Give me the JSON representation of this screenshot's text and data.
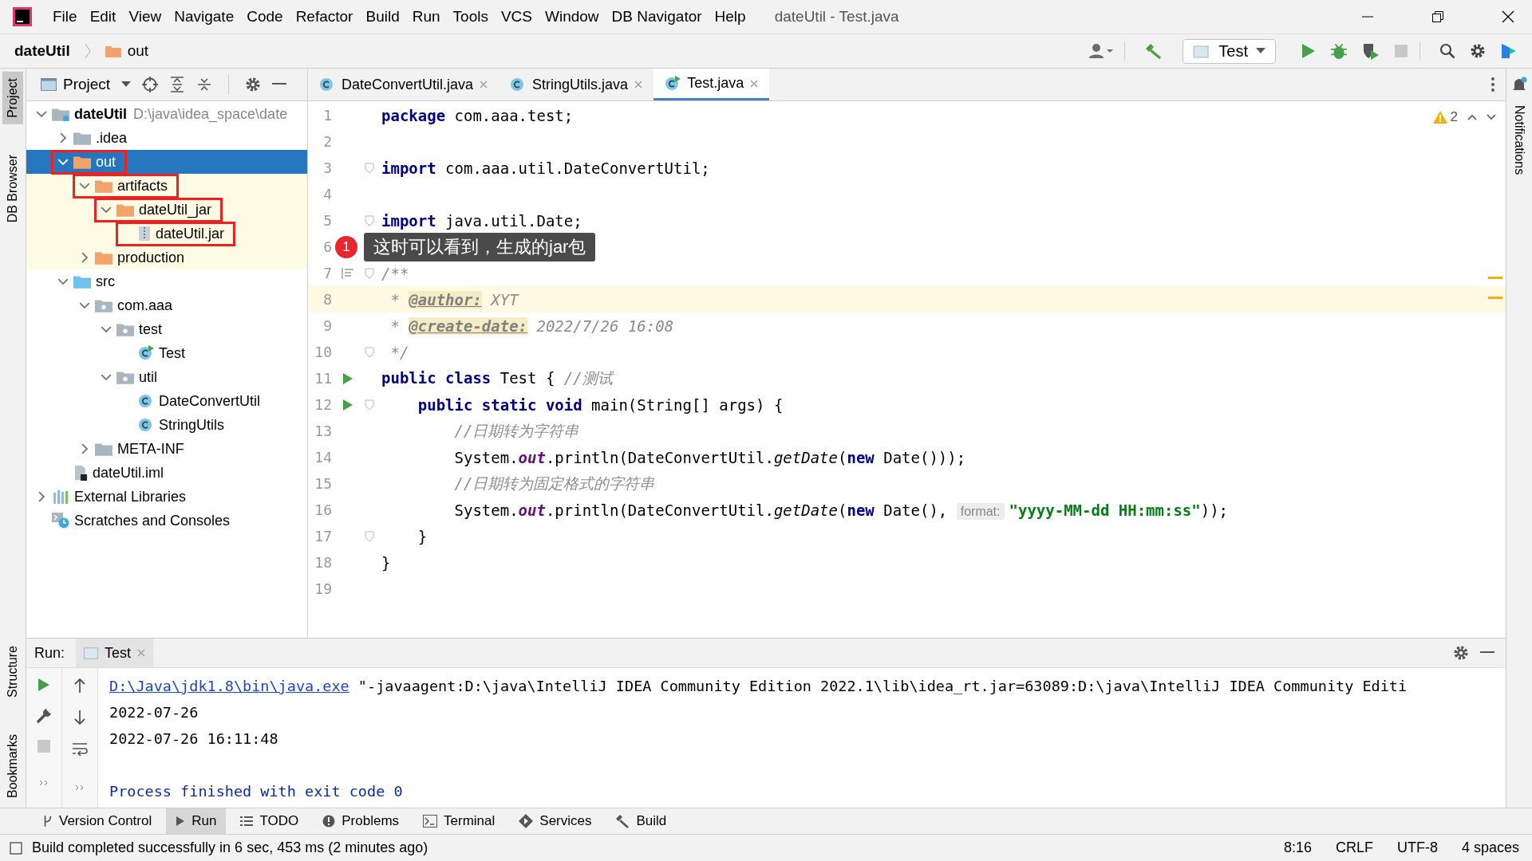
{
  "window": {
    "title": "dateUtil - Test.java"
  },
  "menu": [
    "File",
    "Edit",
    "View",
    "Navigate",
    "Code",
    "Refactor",
    "Build",
    "Run",
    "Tools",
    "VCS",
    "Window",
    "DB Navigator",
    "Help"
  ],
  "breadcrumb": [
    {
      "label": "dateUtil",
      "kind": "project"
    },
    {
      "label": "out",
      "kind": "folder"
    }
  ],
  "run_config": {
    "label": "Test"
  },
  "left_stripe_top": [
    {
      "label": "Project",
      "selected": true
    },
    {
      "label": "DB Browser",
      "selected": false
    }
  ],
  "left_stripe_bottom": [
    {
      "label": "Structure",
      "selected": false
    },
    {
      "label": "Bookmarks",
      "selected": false
    }
  ],
  "right_stripe": [
    {
      "label": "Notifications",
      "selected": false
    }
  ],
  "project_panel": {
    "title": "Project",
    "tree": [
      {
        "label": "dateUtil",
        "location": "D:\\java\\idea_space\\date",
        "kind": "module",
        "expanded": true,
        "selected": false,
        "excluded": false,
        "highlighted": false,
        "children": [
          {
            "label": ".idea",
            "kind": "folder",
            "expanded": false,
            "selected": false,
            "excluded": false,
            "highlighted": false
          },
          {
            "label": "out",
            "kind": "folder",
            "expanded": true,
            "selected": true,
            "excluded": true,
            "highlighted": true,
            "children": [
              {
                "label": "artifacts",
                "kind": "folder",
                "expanded": true,
                "selected": false,
                "excluded": true,
                "highlighted": true,
                "children": [
                  {
                    "label": "dateUtil_jar",
                    "kind": "folder",
                    "expanded": true,
                    "selected": false,
                    "excluded": true,
                    "highlighted": true,
                    "children": [
                      {
                        "label": "dateUtil.jar",
                        "kind": "jar",
                        "selected": false,
                        "excluded": true,
                        "highlighted": true
                      }
                    ]
                  }
                ]
              },
              {
                "label": "production",
                "kind": "folder",
                "expanded": false,
                "selected": false,
                "excluded": true,
                "highlighted": false
              }
            ]
          },
          {
            "label": "src",
            "kind": "source",
            "expanded": true,
            "selected": false,
            "excluded": false,
            "highlighted": false,
            "children": [
              {
                "label": "com.aaa",
                "kind": "package",
                "expanded": true,
                "selected": false,
                "excluded": false,
                "highlighted": false,
                "children": [
                  {
                    "label": "test",
                    "kind": "package",
                    "expanded": true,
                    "selected": false,
                    "excluded": false,
                    "highlighted": false,
                    "children": [
                      {
                        "label": "Test",
                        "kind": "runnable",
                        "selected": false,
                        "excluded": false,
                        "highlighted": false
                      }
                    ]
                  },
                  {
                    "label": "util",
                    "kind": "package",
                    "expanded": true,
                    "selected": false,
                    "excluded": false,
                    "highlighted": false,
                    "children": [
                      {
                        "label": "DateConvertUtil",
                        "kind": "class",
                        "selected": false,
                        "excluded": false,
                        "highlighted": false
                      },
                      {
                        "label": "StringUtils",
                        "kind": "class",
                        "selected": false,
                        "excluded": false,
                        "highlighted": false
                      }
                    ]
                  }
                ]
              },
              {
                "label": "META-INF",
                "kind": "folder",
                "expanded": false,
                "selected": false,
                "excluded": false,
                "highlighted": false
              }
            ]
          },
          {
            "label": "dateUtil.iml",
            "kind": "file",
            "selected": false,
            "excluded": false,
            "highlighted": false
          }
        ]
      },
      {
        "label": "External Libraries",
        "kind": "libraries",
        "expanded": false,
        "selected": false,
        "excluded": false,
        "highlighted": false
      },
      {
        "label": "Scratches and Consoles",
        "kind": "scratches",
        "selected": false,
        "excluded": false,
        "highlighted": false
      }
    ]
  },
  "editor_tabs": [
    {
      "label": "DateConvertUtil.java",
      "kind": "class",
      "selected": false
    },
    {
      "label": "StringUtils.java",
      "kind": "class",
      "selected": false
    },
    {
      "label": "Test.java",
      "kind": "runnable",
      "selected": true
    }
  ],
  "editor": {
    "warnings": "2",
    "lines": [
      {
        "number": "1",
        "current": false,
        "run": false,
        "fold": false,
        "doc": false,
        "tokens": [
          {
            "kind": "keyword",
            "text": "package"
          },
          {
            "kind": "plain",
            "text": " com.aaa.test;"
          }
        ]
      },
      {
        "number": "2",
        "current": false,
        "run": false,
        "fold": false,
        "doc": false
      },
      {
        "number": "3",
        "current": false,
        "run": false,
        "fold": true,
        "doc": false,
        "tokens": [
          {
            "kind": "keyword",
            "text": "import"
          },
          {
            "kind": "plain",
            "text": " com.aaa.util.DateConvertUtil;"
          }
        ]
      },
      {
        "number": "4",
        "current": false,
        "run": false,
        "fold": false,
        "doc": false
      },
      {
        "number": "5",
        "current": false,
        "run": false,
        "fold": true,
        "doc": false,
        "tokens": [
          {
            "kind": "keyword",
            "text": "import"
          },
          {
            "kind": "plain",
            "text": " java.util.Date;"
          }
        ]
      },
      {
        "number": "6",
        "current": false,
        "run": false,
        "fold": false,
        "doc": false
      },
      {
        "number": "7",
        "current": false,
        "run": false,
        "fold": true,
        "doc": true,
        "tokens": [
          {
            "kind": "comment",
            "text": "/**"
          }
        ]
      },
      {
        "number": "8",
        "current": true,
        "run": false,
        "fold": false,
        "doc": false,
        "tokens": [
          {
            "kind": "comment",
            "text": " * "
          },
          {
            "kind": "doctag",
            "text": "@author:"
          },
          {
            "kind": "comment",
            "text": " XYT"
          }
        ]
      },
      {
        "number": "9",
        "current": false,
        "run": false,
        "fold": false,
        "doc": false,
        "tokens": [
          {
            "kind": "comment",
            "text": " * "
          },
          {
            "kind": "doctag",
            "text": "@create-date:"
          },
          {
            "kind": "comment",
            "text": " 2022/7/26 16:08"
          }
        ]
      },
      {
        "number": "10",
        "current": false,
        "run": false,
        "fold": true,
        "doc": false,
        "tokens": [
          {
            "kind": "comment",
            "text": " */"
          }
        ]
      },
      {
        "number": "11",
        "current": false,
        "run": true,
        "fold": false,
        "doc": false,
        "tokens": [
          {
            "kind": "keyword",
            "text": "public class"
          },
          {
            "kind": "plain",
            "text": " Test { "
          },
          {
            "kind": "comment",
            "text": "//测试"
          }
        ]
      },
      {
        "number": "12",
        "current": false,
        "run": true,
        "fold": true,
        "doc": false,
        "tokens": [
          {
            "kind": "keyword",
            "text": "    public static void"
          },
          {
            "kind": "plain",
            "text": " main(String[] args) {"
          }
        ]
      },
      {
        "number": "13",
        "current": false,
        "run": false,
        "fold": false,
        "doc": false,
        "tokens": [
          {
            "kind": "comment",
            "text": "        //日期转为字符串"
          }
        ]
      },
      {
        "number": "14",
        "current": false,
        "run": false,
        "fold": false,
        "doc": false,
        "tokens": [
          {
            "kind": "plain",
            "text": "        System."
          },
          {
            "kind": "field",
            "text": "out"
          },
          {
            "kind": "plain",
            "text": ".println(DateConvertUtil."
          },
          {
            "kind": "static",
            "text": "getDate"
          },
          {
            "kind": "plain",
            "text": "("
          },
          {
            "kind": "keyword",
            "text": "new"
          },
          {
            "kind": "plain",
            "text": " Date()));"
          }
        ]
      },
      {
        "number": "15",
        "current": false,
        "run": false,
        "fold": false,
        "doc": false,
        "tokens": [
          {
            "kind": "comment",
            "text": "        //日期转为固定格式的字符串"
          }
        ]
      },
      {
        "number": "16",
        "current": false,
        "run": false,
        "fold": false,
        "doc": false,
        "tokens": [
          {
            "kind": "plain",
            "text": "        System."
          },
          {
            "kind": "field",
            "text": "out"
          },
          {
            "kind": "plain",
            "text": ".println(DateConvertUtil."
          },
          {
            "kind": "static",
            "text": "getDate"
          },
          {
            "kind": "plain",
            "text": "("
          },
          {
            "kind": "keyword",
            "text": "new"
          },
          {
            "kind": "plain",
            "text": " Date(), "
          },
          {
            "kind": "hint",
            "text": "format:"
          },
          {
            "kind": "string",
            "text": "\"yyyy-MM-dd HH:mm:ss\""
          },
          {
            "kind": "plain",
            "text": "));"
          }
        ]
      },
      {
        "number": "17",
        "current": false,
        "run": false,
        "fold": true,
        "doc": false,
        "tokens": [
          {
            "kind": "plain",
            "text": "    }"
          }
        ]
      },
      {
        "number": "18",
        "current": false,
        "run": false,
        "fold": false,
        "doc": false,
        "tokens": [
          {
            "kind": "plain",
            "text": "}"
          }
        ]
      },
      {
        "number": "19",
        "current": false,
        "run": false,
        "fold": false,
        "doc": false
      }
    ]
  },
  "callout": {
    "badge": "1",
    "text": "这时可以看到，生成的jar包"
  },
  "run_panel": {
    "label": "Run:",
    "tabs": [
      {
        "label": "Test",
        "selected": true
      }
    ],
    "output": [
      {
        "kind": "command",
        "link": "D:\\Java\\jdk1.8\\bin\\java.exe",
        "text": " \"-javaagent:D:\\java\\IntelliJ IDEA Community Edition 2022.1\\lib\\idea_rt.jar=63089:D:\\java\\IntelliJ IDEA Community Editi"
      },
      {
        "kind": "plain",
        "text": "2022-07-26"
      },
      {
        "kind": "plain",
        "text": "2022-07-26 16:11:48"
      },
      {
        "kind": "blank"
      },
      {
        "kind": "exit",
        "text": "Process finished with exit code 0"
      }
    ]
  },
  "tool_tabs": [
    {
      "label": "Version Control",
      "kind": "vcs",
      "selected": false
    },
    {
      "label": "Run",
      "kind": "run",
      "selected": true
    },
    {
      "label": "TODO",
      "kind": "todo",
      "selected": false
    },
    {
      "label": "Problems",
      "kind": "problems",
      "selected": false
    },
    {
      "label": "Terminal",
      "kind": "terminal",
      "selected": false
    },
    {
      "label": "Services",
      "kind": "services",
      "selected": false
    },
    {
      "label": "Build",
      "kind": "build",
      "selected": false
    }
  ],
  "status_bar": {
    "message": "Build completed successfully in 6 sec, 453 ms (2 minutes ago)",
    "items": [
      "8:16",
      "CRLF",
      "UTF-8",
      "4 spaces"
    ]
  }
}
